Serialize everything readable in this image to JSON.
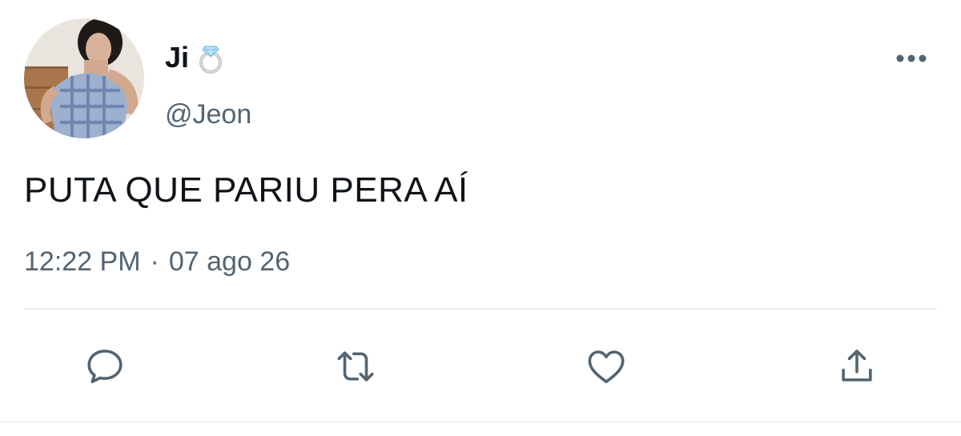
{
  "tweet": {
    "display_name": "Ji",
    "handle": "@Jeon",
    "text": "PUTA QUE PARIU PERA AÍ",
    "time": "12:22 PM",
    "separator": "·",
    "date": "07 ago 26"
  },
  "icons": {
    "more": "more-horizontal-icon",
    "reply": "reply-icon",
    "retweet": "retweet-icon",
    "like": "heart-icon",
    "share": "share-icon",
    "badge": "ring-emoji-icon"
  },
  "colors": {
    "text_primary": "#0f1419",
    "text_secondary": "#536471",
    "icon_gray": "#536471",
    "divider": "#e6ecf0"
  }
}
